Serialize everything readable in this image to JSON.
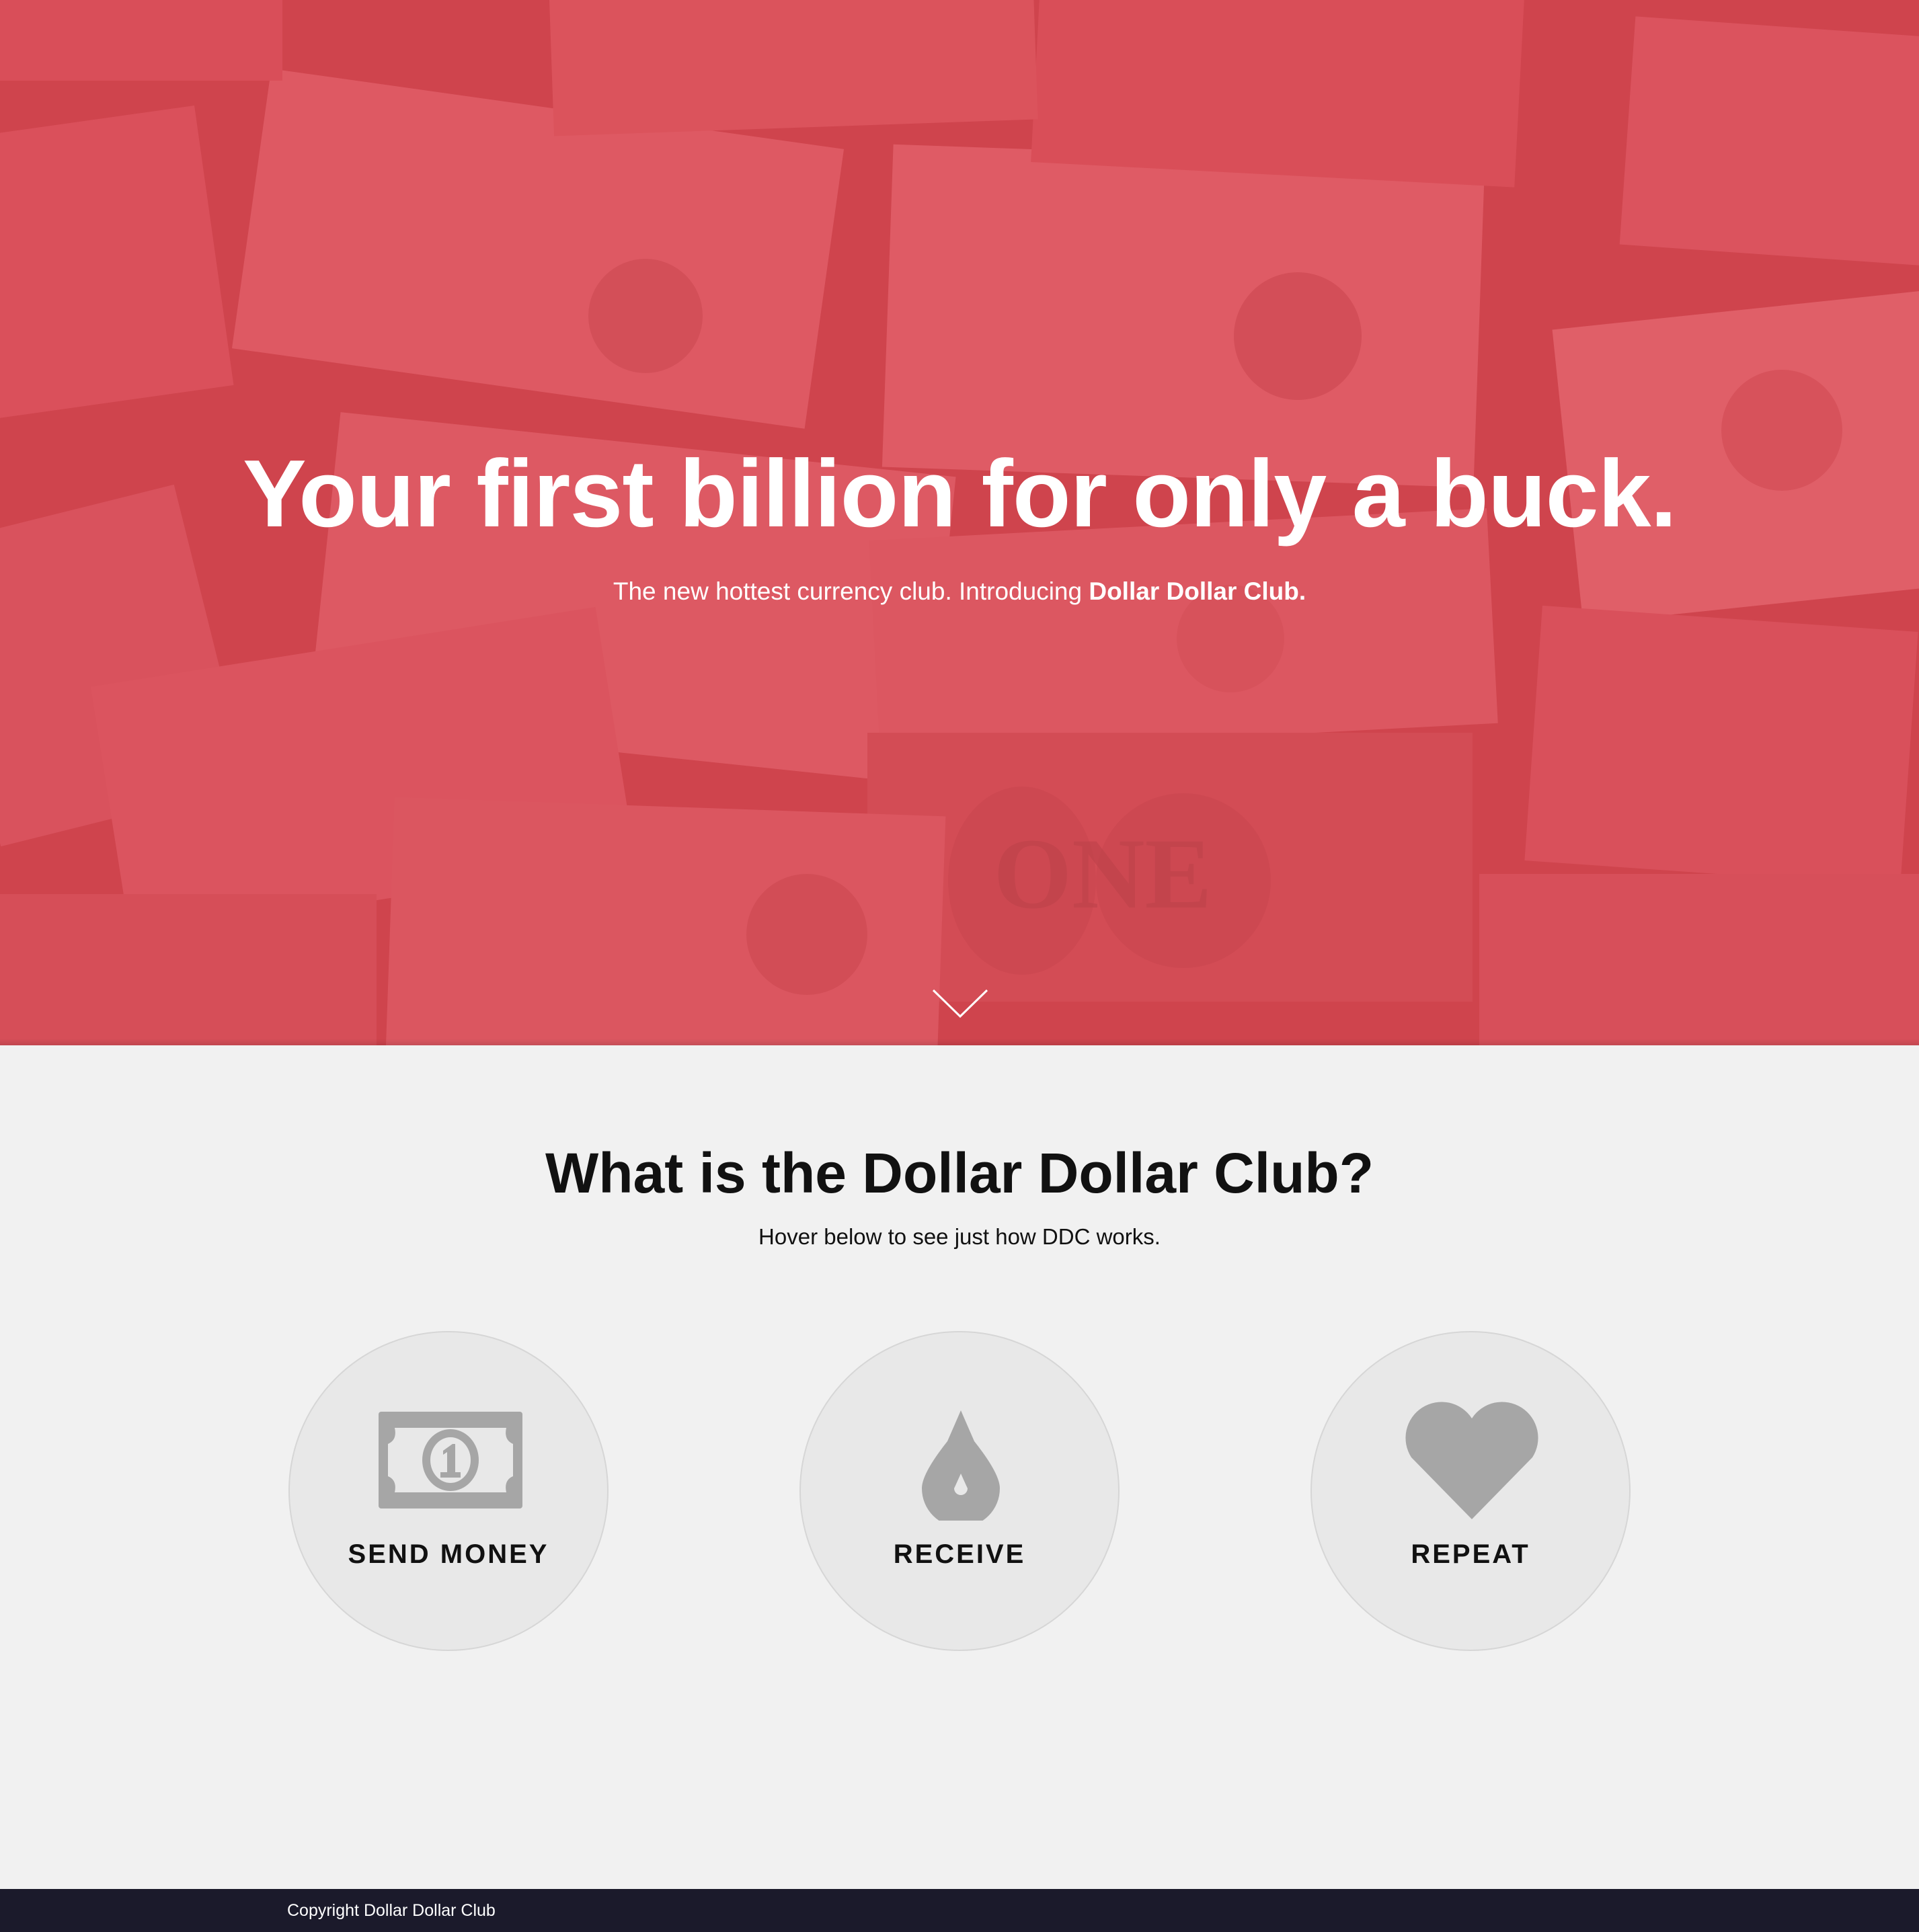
{
  "hero": {
    "title": "Your first billion for only a buck.",
    "subtitle_prefix": "The new hottest currency club. Introducing ",
    "subtitle_brand": "Dollar Dollar Club.",
    "scroll_icon": "chevron-down-icon",
    "overlay_color": "#e24852"
  },
  "about": {
    "title": "What is the Dollar Dollar Club?",
    "subtitle": "Hover below to see just how DDC works.",
    "steps": [
      {
        "label": "SEND MONEY",
        "icon": "dollar-bill-icon"
      },
      {
        "label": "RECEIVE",
        "icon": "drop-icon"
      },
      {
        "label": "REPEAT",
        "icon": "heart-icon"
      }
    ]
  },
  "footer": {
    "copyright": "Copyright Dollar Dollar Club",
    "background": "#1b1a2b"
  }
}
